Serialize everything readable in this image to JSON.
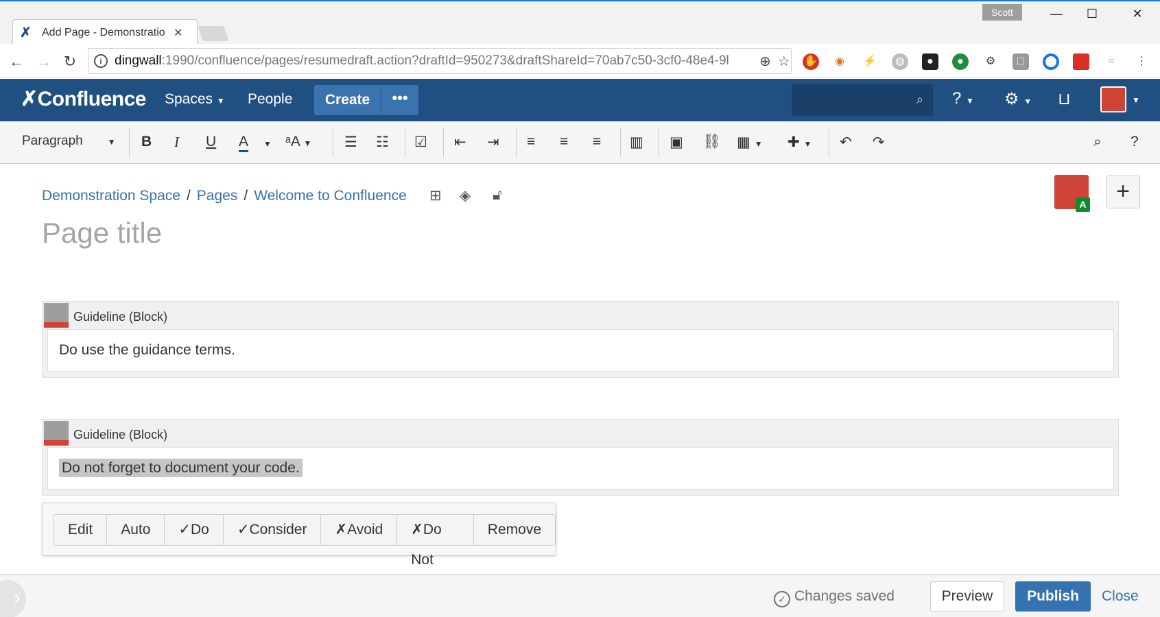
{
  "browser": {
    "tab_title": "Add Page - Demonstration Space",
    "profile_name": "Scott",
    "url_host": "dingwall",
    "url_rest": ":1990/confluence/pages/resumedraft.action?draftId=950273&draftShareId=70ab7c50-3cf0-48e4-9l"
  },
  "header": {
    "logo": "Confluence",
    "nav_spaces": "Spaces",
    "nav_people": "People",
    "create_label": "Create",
    "more_label": "•••"
  },
  "toolbar": {
    "style_select": "Paragraph"
  },
  "page": {
    "breadcrumb": [
      "Demonstration Space",
      "Pages",
      "Welcome to Confluence"
    ],
    "title_placeholder": "Page title",
    "collaborator_badge": "A"
  },
  "macros": [
    {
      "title": "Guideline (Block)",
      "body": "Do use the guidance terms."
    },
    {
      "title": "Guideline (Block)",
      "body": "Do not forget to document your code."
    }
  ],
  "property_panel": {
    "buttons": [
      "Edit",
      "Auto",
      "✓Do",
      "✓Consider",
      "✗Avoid",
      "✗Do Not",
      "Remove"
    ]
  },
  "footer": {
    "status": "Changes saved",
    "preview": "Preview",
    "publish": "Publish",
    "close": "Close"
  },
  "colors": {
    "header_bg": "#205081",
    "create_bg": "#3b73af",
    "link": "#3572b0",
    "avatar": "#d04437",
    "badge": "#14892c"
  }
}
